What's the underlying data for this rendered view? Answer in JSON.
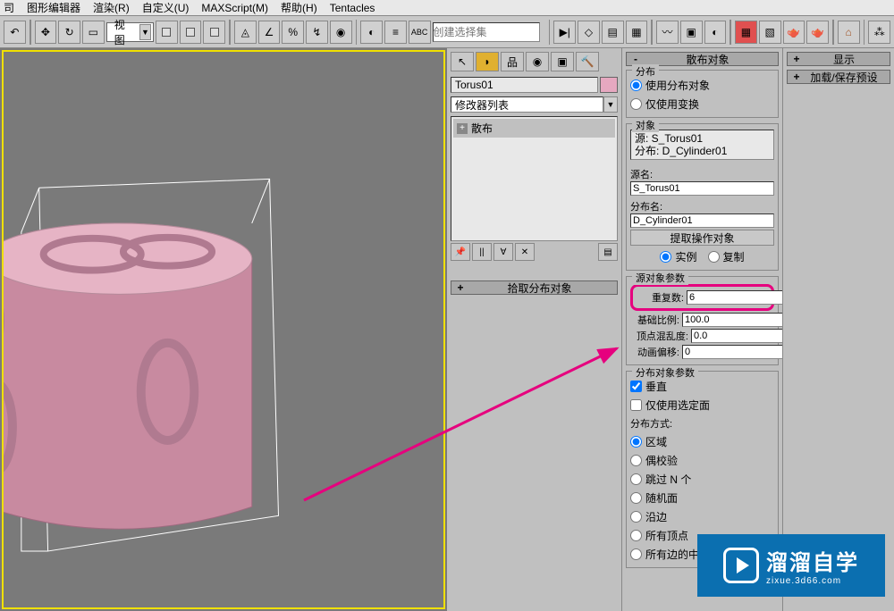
{
  "menu": {
    "items": [
      "图形编辑器",
      "渲染(R)",
      "自定义(U)",
      "MAXScript(M)",
      "帮助(H)",
      "Tentacles"
    ]
  },
  "toolbar": {
    "view_combo": "视图",
    "create_set_placeholder": "创建选择集"
  },
  "modifier": {
    "object_name": "Torus01",
    "list_label": "修改器列表",
    "stack_item": "散布",
    "rollout_pickdist": "拾取分布对象"
  },
  "scatter": {
    "rollout_title": "散布对象",
    "dist_group": "分布",
    "use_dist_obj": "使用分布对象",
    "only_transform": "仅使用变换",
    "obj_group": "对象",
    "source_line": "源: S_Torus01",
    "dist_line": "分布: D_Cylinder01",
    "source_name_lbl": "源名:",
    "source_name_val": "S_Torus01",
    "dist_name_lbl": "分布名:",
    "dist_name_val": "D_Cylinder01",
    "extract_btn": "提取操作对象",
    "instance": "实例",
    "copy": "复制",
    "src_param_group": "源对象参数",
    "duplicates_lbl": "重复数:",
    "duplicates_val": "6",
    "base_scale_lbl": "基础比例:",
    "base_scale_val": "100.0",
    "vertex_chaos_lbl": "顶点混乱度:",
    "vertex_chaos_val": "0.0",
    "anim_offset_lbl": "动画偏移:",
    "anim_offset_val": "0",
    "dist_param_group": "分布对象参数",
    "perpendicular": "垂直",
    "use_selected_faces": "仅使用选定面",
    "dist_method_lbl": "分布方式:",
    "methods": [
      "区域",
      "偶校验",
      "跳过 N 个",
      "随机面",
      "沿边",
      "所有顶点",
      "所有边的中点"
    ]
  },
  "right": {
    "display_rollout": "显示",
    "preset_rollout": "加载/保存预设"
  },
  "watermark": {
    "text": "溜溜自学",
    "sub": "zixue.3d66.com"
  }
}
